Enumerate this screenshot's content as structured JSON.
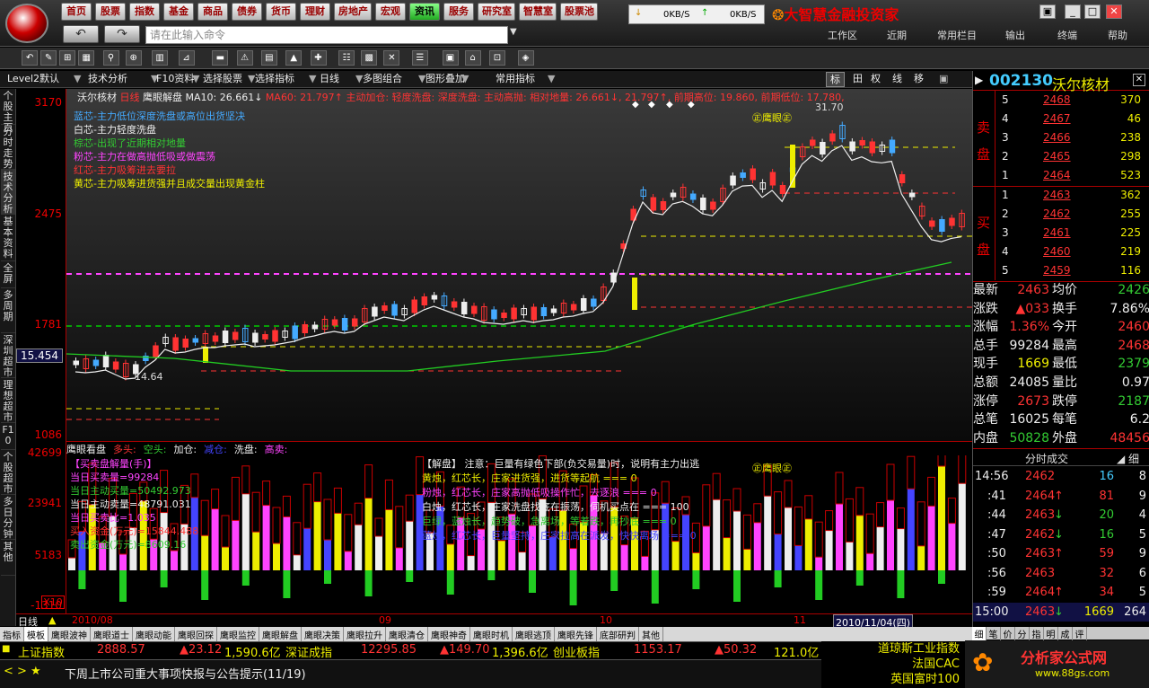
{
  "titlebar": {
    "menus": [
      "首页",
      "股票",
      "指数",
      "基金",
      "商品",
      "债券",
      "货币",
      "理财",
      "房地产",
      "宏观",
      "资讯",
      "服务",
      "研究室",
      "智慧室",
      "股票池"
    ],
    "active_menu": "资讯",
    "command_placeholder": "请在此输入命令",
    "speed_down": "0KB/S",
    "speed_up": "0KB/S",
    "brand": "大智慧金融投资家",
    "sysmenus": [
      "工作区",
      "近期",
      "常用栏目",
      "输出",
      "终端",
      "帮助"
    ]
  },
  "tabs": [
    "Level2默认",
    "技术分析",
    "F10资料",
    "选择股票",
    "选择指标",
    "日线",
    "多图组合",
    "图形叠加",
    "常用指标"
  ],
  "view_tabs": [
    "标",
    "田",
    "权",
    "线",
    "移"
  ],
  "vtabs": [
    "个股主页",
    "分时走势",
    "技术分析",
    "基本资料",
    "全屏",
    "多周期",
    "深圳超市",
    "理想超市",
    "F10",
    "个股超市",
    "多日分钟",
    "其他"
  ],
  "chart": {
    "info_name": "沃尔核材",
    "info_period": "日线",
    "info_indicator": "鹰眼解盘",
    "info_ma10": "MA10: 26.661↓",
    "info_ma60": "MA60: 21.797↑",
    "info_rest": "主动加仓: 轻度洗盘: 深度洗盘: 主动高抛: 相对地量: 26.661↓, 21.797↑, 前期高位: 19.860, 前期低位: 17.780,",
    "y_labels": [
      "3170",
      "2475",
      "1781",
      "1086"
    ],
    "y_selected": "15.454",
    "low_label": "14.64",
    "high_label": "31.70",
    "eagle_label": "㊣鹰眼㊣",
    "legend": [
      {
        "text": "蓝芯-主力低位深度洗盘或高位出货坚决",
        "color": "#4af"
      },
      {
        "text": "白芯-主力轻度洗盘",
        "color": "#eee"
      },
      {
        "text": "棕芯-出现了近期相对地量",
        "color": "#3c3"
      },
      {
        "text": "粉芯-主力在做高抛低吸或做震荡",
        "color": "#f4f"
      },
      {
        "text": "红芯-主力吸筹进去要拉",
        "color": "#f33"
      },
      {
        "text": "黄芯-主力吸筹进货强并且成交量出现黄金柱",
        "color": "#ee0"
      }
    ]
  },
  "lower": {
    "head": [
      {
        "text": "鹰眼看盘",
        "color": "#eee"
      },
      {
        "text": "多头:",
        "color": "#f33"
      },
      {
        "text": "空头:",
        "color": "#3c3"
      },
      {
        "text": "加仓:",
        "color": "#eee"
      },
      {
        "text": "减仓:",
        "color": "#44f"
      },
      {
        "text": "洗盘:",
        "color": "#eee"
      },
      {
        "text": "高卖:",
        "color": "#f4f"
      }
    ],
    "y_labels": [
      "42699",
      "23941",
      "5183",
      "-1310"
    ],
    "legend": [
      {
        "text": "【买卖盘解量(手)】",
        "color": "#f4f"
      },
      {
        "text": "当日买卖量=99284",
        "color": "#f4f"
      },
      {
        "text": "当日主动买量=50492.973",
        "color": "#3c3"
      },
      {
        "text": "当日主动卖量=48791.031",
        "color": "#eee"
      },
      {
        "text": "当日买卖比=1.035",
        "color": "#f4f"
      },
      {
        "text": "买入资金(万元)=15844.488",
        "color": "#f33"
      },
      {
        "text": "卖出资金(万元)=8609.16",
        "color": "#3c3"
      }
    ],
    "explain": [
      {
        "text": "【解盘】 注意：巨量有绿色下部(负交易量)时，说明有主力出逃",
        "color": "#eee"
      },
      {
        "text": "黄烛，红芯长，庄家进货强，进货等起航 === 0",
        "color": "#ee0"
      },
      {
        "text": "粉烛，红芯长，庄家高抛低吸操作忙，去逐浪 === 0",
        "color": "#f4f"
      },
      {
        "text": "白烛，红芯长，庄家洗盘找底在振荡，伺机买点在 === 100",
        "color": "#eee"
      },
      {
        "text": "巨绿，蓝烛长，趋势破，急离场，等着跌，再抄底 === 0",
        "color": "#3c3"
      },
      {
        "text": "蓝烛，红芯长，巨量坚持，庄家拉高在派发，快快离场 === 0",
        "color": "#44f"
      }
    ],
    "eagle_label": "㊣鹰眼㊣",
    "x10": "X10"
  },
  "dates": {
    "period": "日线",
    "d1": "2010/08",
    "d2": "09",
    "d3": "10",
    "d4": "11",
    "current": "2010/11/04(四)"
  },
  "bottom_tabs": [
    "指标",
    "模板",
    "鹰眼波神",
    "鹰眼道士",
    "鹰眼动能",
    "鹰眼回探",
    "鹰眼监控",
    "鹰眼解盘",
    "鹰眼决策",
    "鹰眼拉升",
    "鹰眼清仓",
    "鹰眼神奇",
    "鹰眼时机",
    "鹰眼逃顶",
    "鹰眼先锋",
    "底部研判",
    "其他"
  ],
  "index_bar": [
    {
      "name": "上证指数",
      "value": "2888.57",
      "change": "▲23.12",
      "amount": "1,590.6亿"
    },
    {
      "name": "深证成指",
      "value": "12295.85",
      "change": "▲149.70",
      "amount": "1,396.6亿"
    },
    {
      "name": "创业板指",
      "value": "1153.17",
      "change": "▲50.32",
      "amount": "121.0亿"
    }
  ],
  "ticker": "下周上市公司重大事项快报与公告提示(11/19)",
  "right_index": [
    "道琼斯工业指数",
    "法国CAC",
    "英国富时100"
  ],
  "watermark": {
    "title": "分析家公式网",
    "url": "www.88gs.com"
  },
  "stock": {
    "code": "002130",
    "name": "沃尔核材",
    "sell_label": "卖 盘",
    "buy_label": "买 盘",
    "asks": [
      {
        "lv": "5",
        "price": "2468",
        "vol": "370"
      },
      {
        "lv": "4",
        "price": "2467",
        "vol": "46"
      },
      {
        "lv": "3",
        "price": "2466",
        "vol": "238"
      },
      {
        "lv": "2",
        "price": "2465",
        "vol": "298"
      },
      {
        "lv": "1",
        "price": "2464",
        "vol": "523"
      }
    ],
    "bids": [
      {
        "lv": "1",
        "price": "2463",
        "vol": "362"
      },
      {
        "lv": "2",
        "price": "2462",
        "vol": "255"
      },
      {
        "lv": "3",
        "price": "2461",
        "vol": "225"
      },
      {
        "lv": "4",
        "price": "2460",
        "vol": "219"
      },
      {
        "lv": "5",
        "price": "2459",
        "vol": "116"
      }
    ],
    "stats": [
      {
        "l": "最新",
        "v": "2463",
        "l2": "均价",
        "v2": "2426",
        "c": "red",
        "c2": "green"
      },
      {
        "l": "涨跌",
        "v": "▲033",
        "l2": "换手",
        "v2": "7.86%",
        "c": "red",
        "c2": "white"
      },
      {
        "l": "涨幅",
        "v": "1.36%",
        "l2": "今开",
        "v2": "2460",
        "c": "red",
        "c2": "red"
      },
      {
        "l": "总手",
        "v": "99284",
        "l2": "最高",
        "v2": "2468",
        "c": "white",
        "c2": "red"
      },
      {
        "l": "现手",
        "v": "1669",
        "l2": "最低",
        "v2": "2379",
        "c": "yellow",
        "c2": "green"
      },
      {
        "l": "总额",
        "v": "24085",
        "l2": "量比",
        "v2": "0.97",
        "c": "white",
        "c2": "white"
      },
      {
        "l": "涨停",
        "v": "2673",
        "l2": "跌停",
        "v2": "2187",
        "c": "red",
        "c2": "green"
      },
      {
        "l": "总笔",
        "v": "16025",
        "l2": "每笔",
        "v2": "6.2",
        "c": "white",
        "c2": "white"
      },
      {
        "l": "内盘",
        "v": "50828",
        "l2": "外盘",
        "v2": "48456",
        "c": "green",
        "c2": "red"
      }
    ],
    "trades_title": "分时成交",
    "trades": [
      {
        "t": "14:56",
        "p": "2462",
        "a": "",
        "v": "16",
        "s": "8",
        "vc": "cyan"
      },
      {
        "t": ":41",
        "p": "2464",
        "a": "↑",
        "v": "81",
        "s": "9",
        "vc": "red"
      },
      {
        "t": ":44",
        "p": "2463",
        "a": "↓",
        "v": "20",
        "s": "4",
        "vc": "green"
      },
      {
        "t": ":47",
        "p": "2462",
        "a": "↓",
        "v": "16",
        "s": "5",
        "vc": "green"
      },
      {
        "t": ":50",
        "p": "2463",
        "a": "↑",
        "v": "59",
        "s": "9",
        "vc": "red"
      },
      {
        "t": ":56",
        "p": "2463",
        "a": "",
        "v": "32",
        "s": "6",
        "vc": "red"
      },
      {
        "t": ":59",
        "p": "2464",
        "a": "↑",
        "v": "34",
        "s": "5",
        "vc": "red"
      },
      {
        "t": "15:00",
        "p": "2463",
        "a": "↓",
        "v": "1669",
        "s": "264",
        "vc": "yellow"
      }
    ],
    "bottom_tabs": [
      "细",
      "笔",
      "价",
      "分",
      "指",
      "明",
      "成",
      "评"
    ]
  }
}
